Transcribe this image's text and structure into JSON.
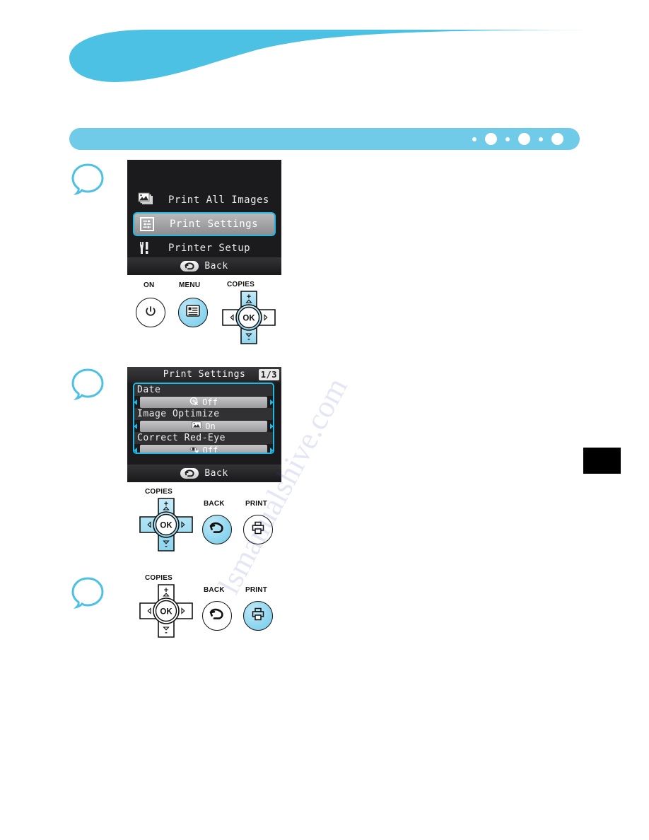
{
  "page": {
    "pagination": {
      "groups": 3,
      "dot_small": "small-dot",
      "dot_large": "large-dot"
    },
    "accent_color": "#6fcbe8",
    "lcd_highlight_color": "#23b6e0"
  },
  "steps": [
    {
      "bubble": "step-bubble-1"
    },
    {
      "bubble": "step-bubble-2"
    },
    {
      "bubble": "step-bubble-3"
    }
  ],
  "screen1": {
    "items": [
      {
        "icon": "photos-stack-icon",
        "label": "Print All Images",
        "selected": false
      },
      {
        "icon": "print-settings-icon",
        "label": "Print Settings",
        "selected": true
      },
      {
        "icon": "printer-setup-tools-icon",
        "label": "Printer Setup",
        "selected": false
      }
    ],
    "back_label": "Back"
  },
  "screen2": {
    "title": "Print Settings",
    "page_current": "1",
    "page_separator": "/",
    "page_total": "3",
    "settings": [
      {
        "label": "Date",
        "icon": "date-off-icon",
        "value": "Off"
      },
      {
        "label": "Image Optimize",
        "icon": "image-optimize-icon",
        "value": "On"
      },
      {
        "label": "Correct Red-Eye",
        "icon": "red-eye-off-icon",
        "value": "Off"
      }
    ],
    "back_label": "Back"
  },
  "buttons_step1": {
    "on": {
      "label": "ON",
      "icon": "power-icon",
      "active": false
    },
    "menu": {
      "label": "MENU",
      "icon": "menu-list-icon",
      "active": true
    },
    "dpad": {
      "copies_label": "COPIES",
      "ok_label": "OK",
      "plus": "+",
      "minus": "-",
      "up_arrow": "up-arrow-icon",
      "down_arrow": "down-arrow-icon",
      "left_arrow": "left-arrow-icon",
      "right_arrow": "right-arrow-icon",
      "vertical_active": true,
      "horizontal_active": false,
      "ok_active": false
    }
  },
  "buttons_step2": {
    "dpad": {
      "copies_label": "COPIES",
      "ok_label": "OK",
      "plus": "+",
      "minus": "-",
      "vertical_active": true,
      "horizontal_active": true,
      "ok_active": false
    },
    "back": {
      "label": "BACK",
      "icon": "back-arrow-icon",
      "active": true
    },
    "print": {
      "label": "PRINT",
      "icon": "printer-icon",
      "active": false
    }
  },
  "buttons_step3": {
    "dpad": {
      "copies_label": "COPIES",
      "ok_label": "OK",
      "plus": "+",
      "minus": "-",
      "vertical_active": false,
      "horizontal_active": false,
      "ok_active": false
    },
    "back": {
      "label": "BACK",
      "icon": "back-arrow-icon",
      "active": false
    },
    "print": {
      "label": "PRINT",
      "icon": "printer-icon",
      "active": true
    }
  },
  "watermark": {
    "text": "lsmanualshive.com"
  }
}
